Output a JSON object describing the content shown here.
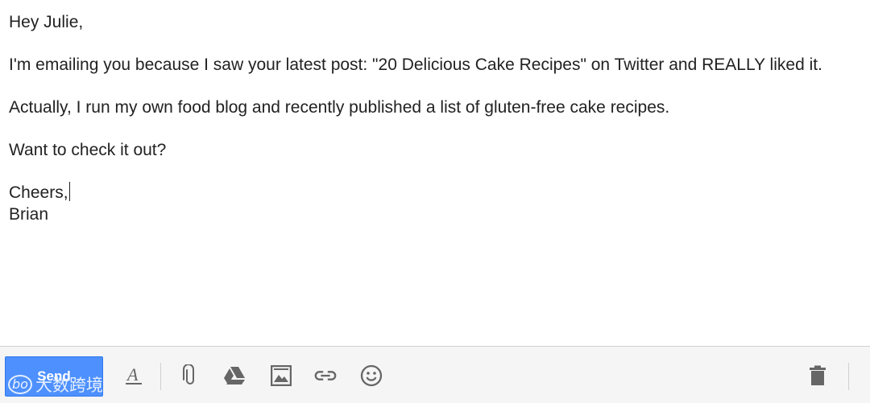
{
  "email": {
    "greeting": "Hey Julie,",
    "paragraph_1": "I'm emailing you because I saw your latest post: \"20 Delicious Cake Recipes\" on Twitter and REALLY liked it.",
    "paragraph_2": "Actually, I run my own food blog and recently published a list of gluten-free cake recipes.",
    "paragraph_3": "Want to check it out?",
    "signoff": "Cheers,",
    "signature": "Brian"
  },
  "toolbar": {
    "send_label": "Send",
    "icons": [
      "formatting-icon",
      "attach-icon",
      "drive-icon",
      "photo-icon",
      "link-icon",
      "emoji-icon",
      "trash-icon"
    ]
  },
  "watermark": {
    "logo_text": "bo",
    "text": "大数跨境"
  },
  "colors": {
    "send_button": "#4d90fe",
    "toolbar_bg": "#f5f5f5",
    "icon": "#666666"
  }
}
